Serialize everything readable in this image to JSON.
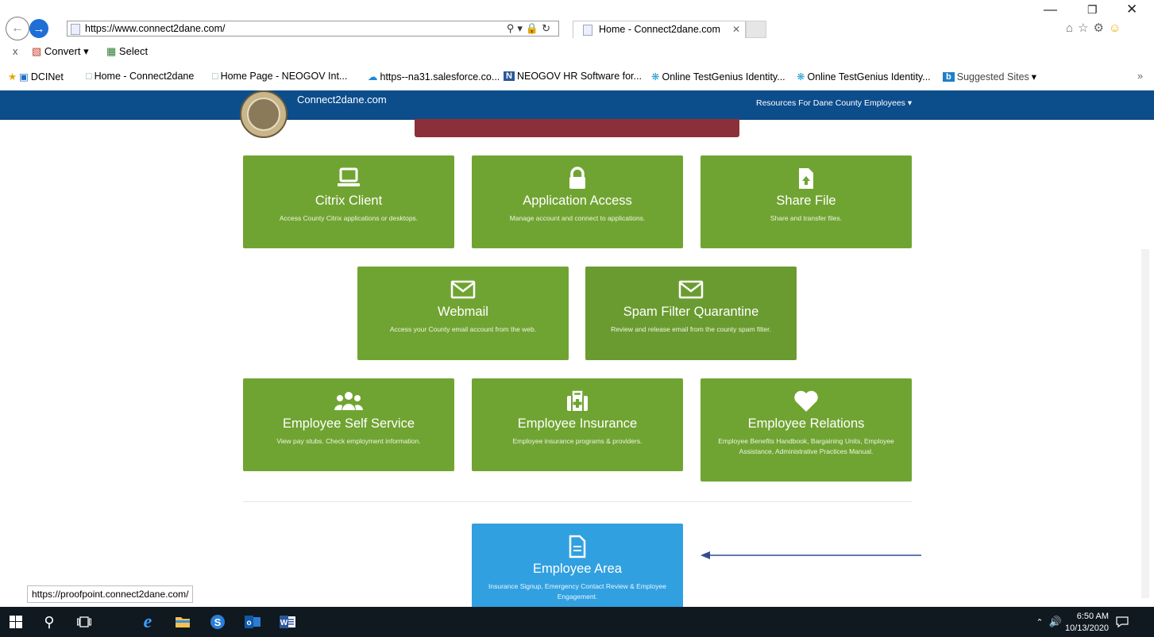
{
  "browser": {
    "address_url": "https://www.connect2dane.com/",
    "tab_title": "Home - Connect2dane.com",
    "command_bar": {
      "close_label": "x",
      "convert_label": "Convert",
      "select_label": "Select"
    },
    "favorites": [
      {
        "label": "DCINet",
        "icon": "ie-page-icon"
      },
      {
        "label": "Home - Connect2dane",
        "icon": "page-icon"
      },
      {
        "label": "Home Page - NEOGOV Int...",
        "icon": "page-icon"
      },
      {
        "label": "https--na31.salesforce.co...",
        "icon": "cloud-icon"
      },
      {
        "label": "NEOGOV HR Software for...",
        "icon": "neogov-icon"
      },
      {
        "label": "Online TestGenius Identity...",
        "icon": "sparkle-icon"
      },
      {
        "label": "Online TestGenius Identity...",
        "icon": "sparkle-icon"
      },
      {
        "label": "Suggested Sites",
        "icon": "bing-icon"
      }
    ],
    "status_url": "https://proofpoint.connect2dane.com/"
  },
  "site": {
    "brand": "Connect2dane.com",
    "resources_menu": "Resources For Dane County Employees",
    "tiles": [
      {
        "title": "Citrix Client",
        "desc": "Access County Citrix applications or desktops.",
        "icon": "laptop-icon"
      },
      {
        "title": "Application Access",
        "desc": "Manage account and connect to applications.",
        "icon": "lock-icon"
      },
      {
        "title": "Share File",
        "desc": "Share and transfer files.",
        "icon": "file-upload-icon"
      },
      {
        "title": "Webmail",
        "desc": "Access your County email account from the web.",
        "icon": "envelope-icon"
      },
      {
        "title": "Spam Filter Quarantine",
        "desc": "Review and release email from the county spam filter.",
        "icon": "envelope-icon"
      },
      {
        "title": "Employee Self Service",
        "desc": "View pay stubs. Check employment information.",
        "icon": "users-icon"
      },
      {
        "title": "Employee Insurance",
        "desc": "Employee insurance programs & providers.",
        "icon": "medkit-icon"
      },
      {
        "title": "Employee Relations",
        "desc": "Employee Benefits Handbook, Bargaining Units, Employee Assistance, Administrative Practices Manual.",
        "icon": "heart-icon"
      },
      {
        "title": "Employee Area",
        "desc": "Insurance Signup, Emergency Contact Review & Employee Engagement.",
        "icon": "document-icon"
      }
    ]
  },
  "taskbar": {
    "time": "6:50 AM",
    "date": "10/13/2020"
  }
}
